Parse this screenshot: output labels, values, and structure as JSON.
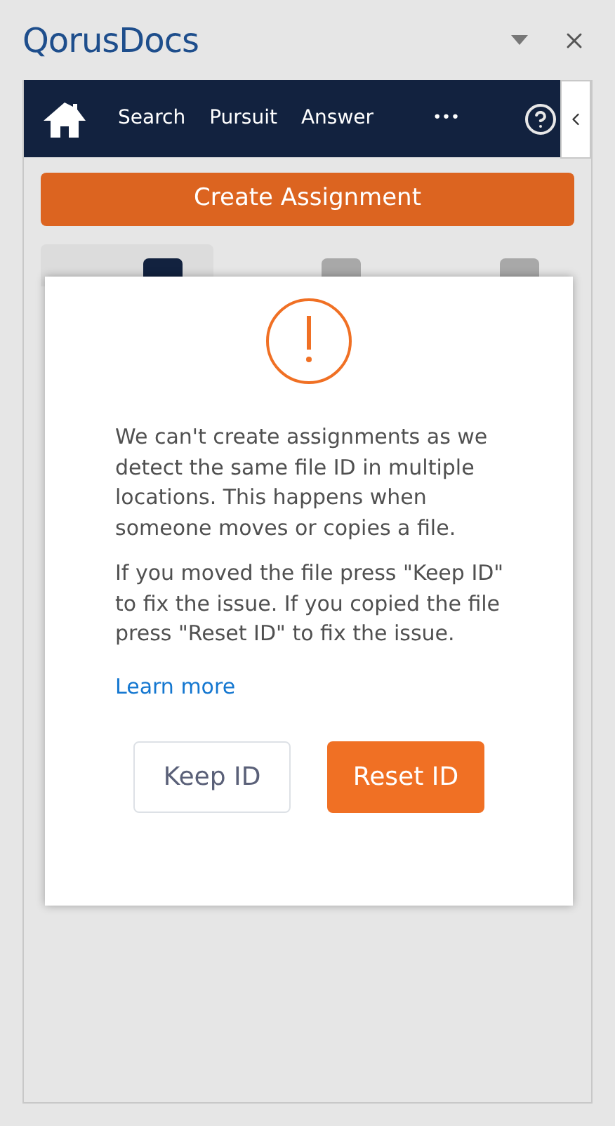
{
  "pane": {
    "title": "QorusDocs"
  },
  "nav": {
    "items": [
      {
        "label": "Search"
      },
      {
        "label": "Pursuit"
      },
      {
        "label": "Answer"
      },
      {
        "label": "•••"
      }
    ]
  },
  "create_button": "Create Assignment",
  "tabs": [
    {
      "selected": true
    },
    {
      "selected": false
    },
    {
      "selected": false
    }
  ],
  "dialog": {
    "paragraphs": [
      "We can't create assignments as we detect the same file ID in multiple locations. This happens when someone moves or copies a file.",
      "If you moved the file press \"Keep ID\" to fix the issue. If you copied the file press \"Reset ID\" to fix the issue."
    ],
    "link": "Learn more",
    "buttons": [
      {
        "label": "Keep ID",
        "kind": "secondary"
      },
      {
        "label": "Reset ID",
        "kind": "primary"
      }
    ]
  }
}
